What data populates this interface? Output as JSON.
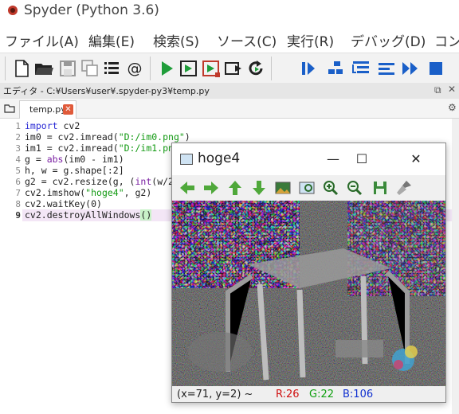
{
  "app": {
    "title": "Spyder (Python 3.6)"
  },
  "menu": [
    "ファイル(A)",
    "編集(E)",
    "検索(S)",
    "ソース(C)",
    "実行(R)",
    "デバッグ(D)",
    "コン"
  ],
  "toolbar": {
    "icons": [
      "new-file-icon",
      "open-folder-icon",
      "save-icon",
      "save-all-icon",
      "list-icon",
      "at-icon",
      "run-icon",
      "run-cell-icon",
      "run-cell-advance-icon",
      "run-selection-icon",
      "rerun-icon",
      "debug-icon",
      "step-icon",
      "step-into-icon",
      "step-return-icon",
      "continue-icon",
      "stop-debug-icon"
    ]
  },
  "editor": {
    "title": "エディタ - C:¥Users¥user¥.spyder-py3¥temp.py",
    "tab_label": "temp.py",
    "lines": [
      "1",
      "2",
      "3",
      "4",
      "5",
      "6",
      "7",
      "8",
      "9"
    ]
  },
  "cv_window": {
    "title": "hoge4",
    "minimize": "—",
    "maximize": "☐",
    "close": "✕",
    "status": {
      "coords": "(x=71, y=2) ~",
      "r": "R:26",
      "g": "G:22",
      "b": "B:106"
    },
    "tool_icons": [
      "pan-left-icon",
      "pan-right-icon",
      "pan-up-icon",
      "pan-down-icon",
      "image-icon",
      "zoom-region-icon",
      "zoom-in-icon",
      "zoom-out-icon",
      "save-image-icon",
      "properties-icon"
    ]
  },
  "colors": {
    "keyword": "#2b2bd5",
    "string": "#139a13",
    "builtin": "#7a1fa2",
    "run_green": "#1f9d3a",
    "debug_blue": "#1a5fc8"
  }
}
